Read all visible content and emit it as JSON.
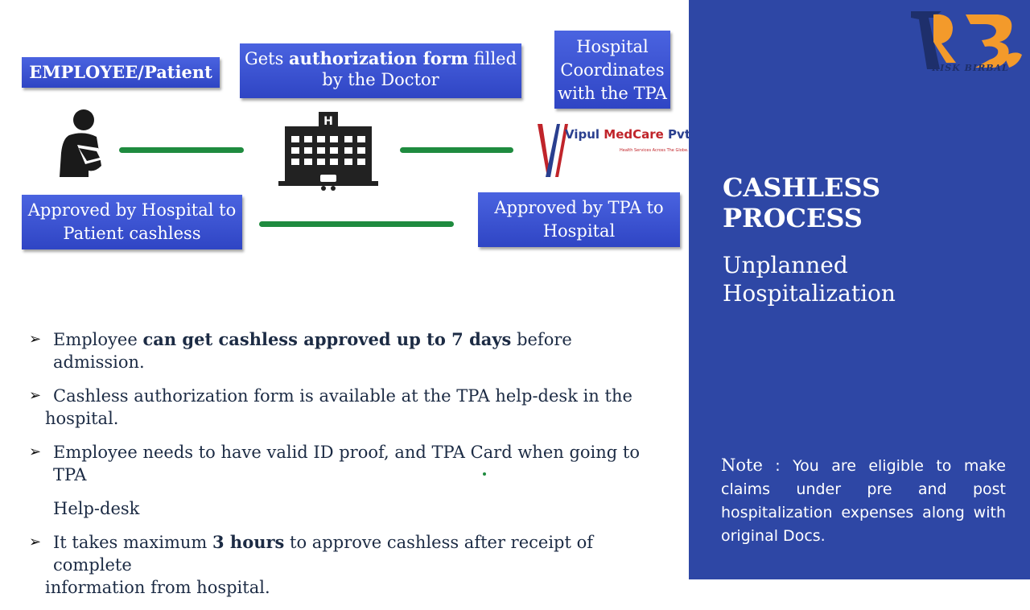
{
  "flow": {
    "employee_label": "EMPLOYEE/Patient",
    "doctor_pre": "Gets ",
    "doctor_bold": "authorization form",
    "doctor_post": " filled by the Doctor",
    "hospital_coord": "Hospital Coordinates with the TPA",
    "approved_hospital": "Approved  by Hospital to Patient cashless",
    "approved_tpa": "Approved  by TPA to Hospital",
    "hospital_icon_letter": "H"
  },
  "vipul_logo": {
    "name": "Vipul",
    "medcare": "MedCare",
    "suffix": " Pvt Ltd.",
    "tagline": "Health Services Across The Globe..."
  },
  "bullets": {
    "b1_pre": "Employee ",
    "b1_bold": "can get cashless approved up to 7 days",
    "b1_post": " before admission.",
    "b2_line1": "Cashless authorization form is available at the TPA help-desk in the",
    "b2_line2": "hospital.",
    "b3_line1": "Employee needs to have valid ID proof, and TPA Card when going to TPA",
    "b3_line2": "Help-desk",
    "b4_pre": "It takes maximum ",
    "b4_bold": "3 hours",
    "b4_post": " to approve cashless after receipt of complete",
    "b4_line2": "information from hospital."
  },
  "panel": {
    "title_line1": "CASHLESS",
    "title_line2": "PROCESS",
    "subtitle_line1": "Unplanned",
    "subtitle_line2": "Hospitalization",
    "note_label": "Note",
    "note_text": " : You are eligible to make claims under pre and post hospitalization expenses along with original Docs."
  },
  "logo": {
    "text": "RISK BIRBAL"
  },
  "colors": {
    "box_blue": "#3b55d4",
    "panel_blue": "#2e47a5",
    "line_green": "#1f8b3f",
    "logo_orange": "#f39a2b"
  },
  "icons": [
    "patient-icon",
    "hospital-building-icon",
    "vipul-medcare-logo",
    "risk-birbal-logo",
    "arrow-bullet-icon"
  ]
}
